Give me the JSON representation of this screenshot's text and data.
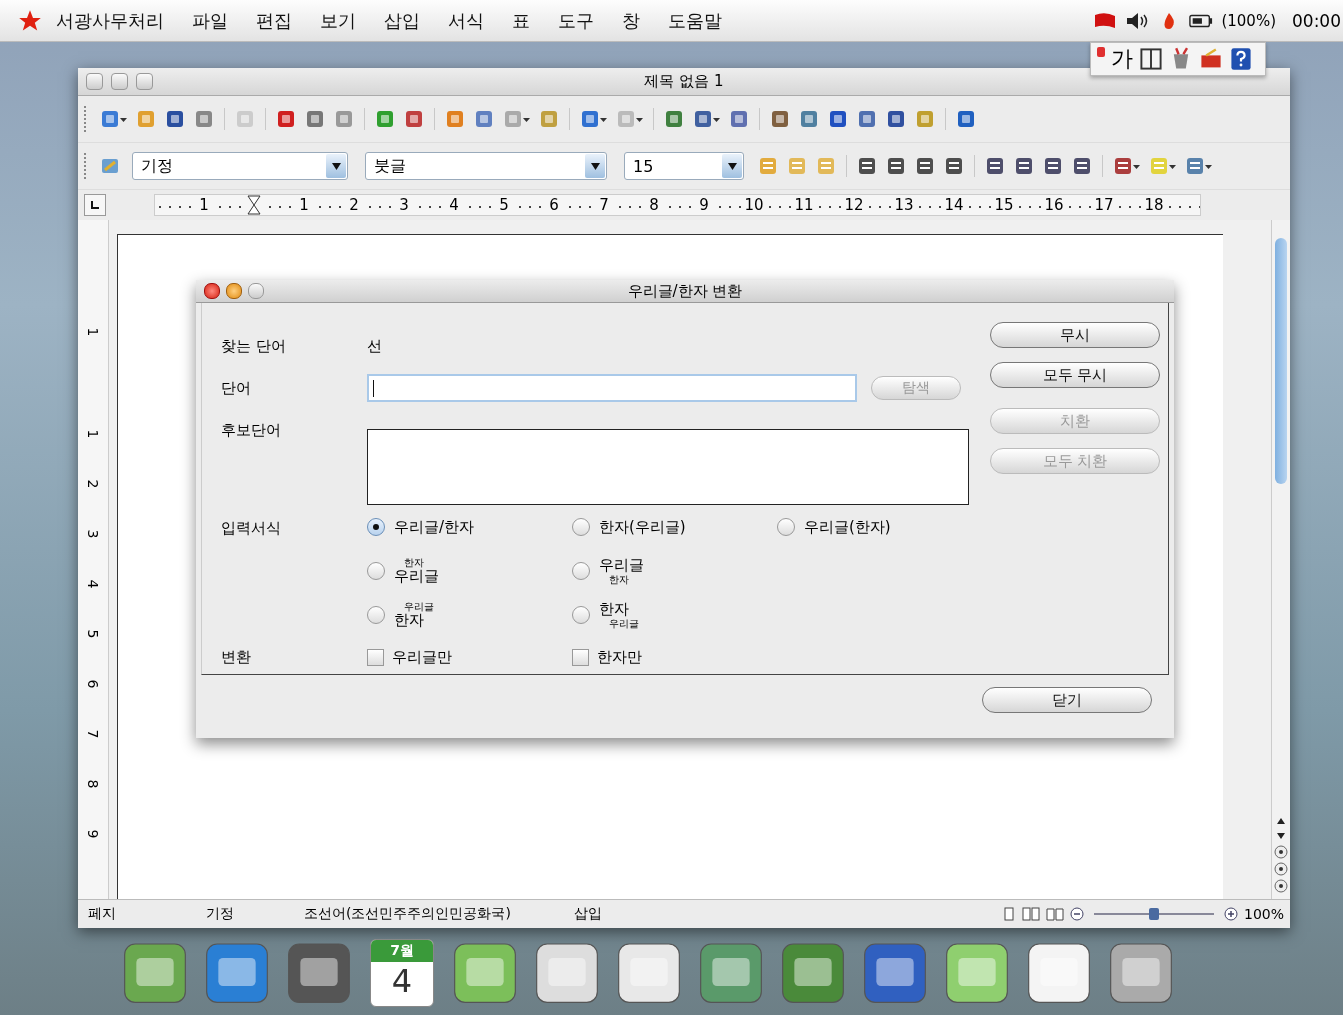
{
  "menu_bar": {
    "app_name": "서광사무처리",
    "menus": [
      "파일",
      "편집",
      "보기",
      "삽입",
      "서식",
      "표",
      "도구",
      "창",
      "도움말"
    ],
    "battery": "(100%)",
    "clock": "00:00"
  },
  "input_palette": {
    "label": "가"
  },
  "window": {
    "title": "제목 없음 1"
  },
  "formatting": {
    "style": "기정",
    "font": "붓글",
    "size": "15"
  },
  "ruler": {
    "labels": [
      "1",
      "1",
      "2",
      "3",
      "4",
      "5",
      "6",
      "7",
      "8",
      "9",
      "10",
      "11",
      "12",
      "13",
      "14",
      "15",
      "16",
      "17",
      "18"
    ]
  },
  "vertical_ruler": {
    "labels": [
      "1",
      "1",
      "2",
      "3",
      "4",
      "5",
      "6",
      "7",
      "8",
      "9"
    ]
  },
  "dialog": {
    "title": "우리글/한자 변환",
    "find_word": {
      "label": "찾는 단어",
      "value": "선"
    },
    "word": {
      "label": "단어"
    },
    "search_button": {
      "label": "탐색",
      "disabled": true
    },
    "candidates": {
      "label": "후보단어"
    },
    "format": {
      "label": "입력서식",
      "rows": [
        [
          {
            "kind": "inline",
            "text": "우리글/한자",
            "selected": true
          },
          {
            "kind": "inline",
            "text": "한자(우리글)",
            "selected": false
          },
          {
            "kind": "inline",
            "text": "우리글(한자)",
            "selected": false
          }
        ],
        [
          {
            "kind": "ruby_above",
            "annotation": "한자",
            "text": "우리글",
            "selected": false
          },
          {
            "kind": "ruby_below",
            "text": "우리글",
            "annotation": "한자",
            "selected": false
          }
        ],
        [
          {
            "kind": "ruby_above",
            "annotation": "우리글",
            "text": "한자",
            "selected": false
          },
          {
            "kind": "ruby_below",
            "text": "한자",
            "annotation": "우리글",
            "selected": false
          }
        ]
      ]
    },
    "convert": {
      "label": "변환",
      "options": [
        {
          "text": "우리글만",
          "checked": false
        },
        {
          "text": "한자만",
          "checked": false
        }
      ]
    },
    "buttons": [
      {
        "label": "무시",
        "disabled": false
      },
      {
        "label": "모두 무시",
        "disabled": false
      },
      {
        "label": "치환",
        "disabled": true
      },
      {
        "label": "모두 치환",
        "disabled": true
      }
    ],
    "close_button": {
      "label": "닫기"
    }
  },
  "status_bar": {
    "page": "페지",
    "style": "기정",
    "language": "조선어(조선민주주의인민공화국)",
    "mode": "삽입",
    "zoom_slider": {
      "level": 0.5
    },
    "zoom": "100%"
  },
  "dock": {
    "calendar": {
      "month": "7월",
      "day": "4"
    }
  }
}
